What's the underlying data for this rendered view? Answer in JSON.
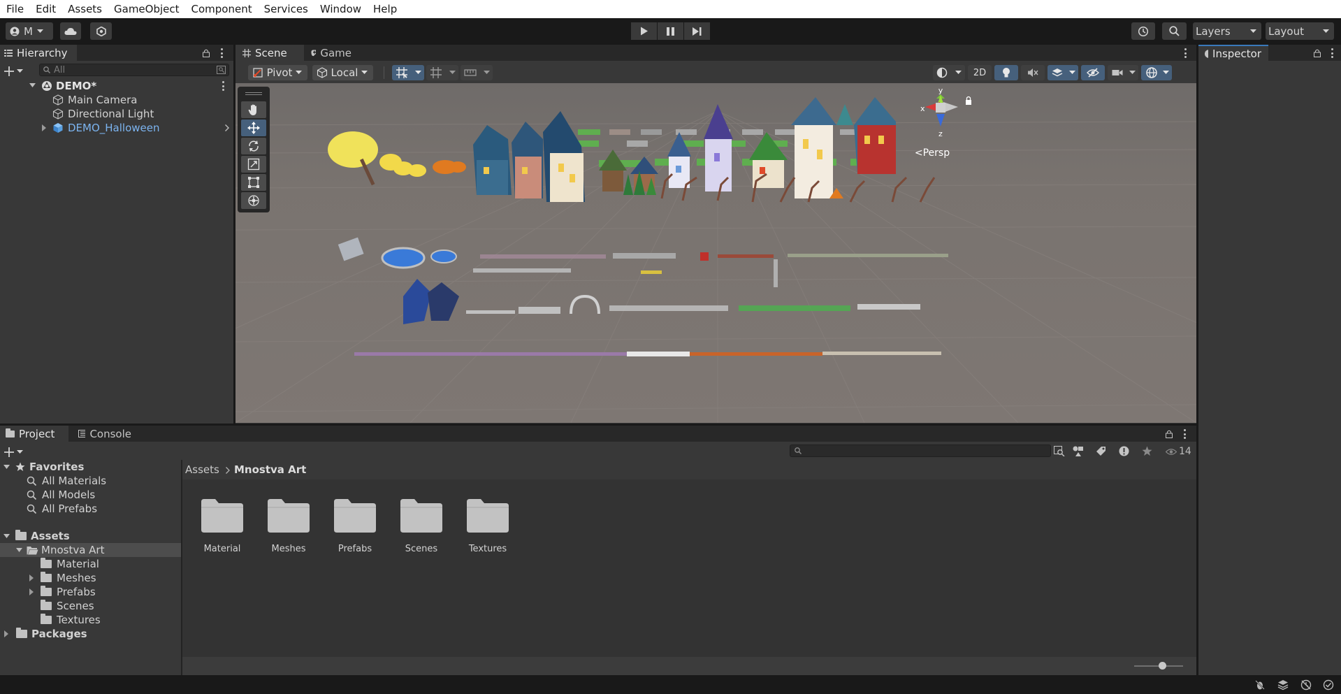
{
  "menu": [
    "File",
    "Edit",
    "Assets",
    "GameObject",
    "Component",
    "Services",
    "Window",
    "Help"
  ],
  "toolbar": {
    "account_label": "M",
    "layers_label": "Layers",
    "layout_label": "Layout"
  },
  "hierarchy": {
    "tab_label": "Hierarchy",
    "search_placeholder": "All",
    "scene_name": "DEMO*",
    "items": [
      {
        "label": "Main Camera",
        "icon": "gameobject-cube-icon"
      },
      {
        "label": "Directional Light",
        "icon": "gameobject-cube-icon"
      },
      {
        "label": "DEMO_Halloween",
        "icon": "prefab-cube-icon"
      }
    ]
  },
  "scene": {
    "tabs": [
      {
        "label": "Scene",
        "icon": "hash-icon"
      },
      {
        "label": "Game",
        "icon": "gamepad-icon"
      }
    ],
    "pivot_label": "Pivot",
    "local_label": "Local",
    "mode_2d_label": "2D",
    "persp_label": "<Persp",
    "gizmo_axes": {
      "x": "x",
      "y": "y",
      "z": "z"
    }
  },
  "inspector": {
    "tab_label": "Inspector"
  },
  "project": {
    "tabs": [
      {
        "label": "Project",
        "icon": "folder-icon"
      },
      {
        "label": "Console",
        "icon": "console-icon"
      }
    ],
    "hidden_count": "14",
    "favorites": {
      "label": "Favorites",
      "items": [
        "All Materials",
        "All Models",
        "All Prefabs"
      ]
    },
    "assets_label": "Assets",
    "selected_folder": "Mnostva Art",
    "subfolders": [
      "Material",
      "Meshes",
      "Prefabs",
      "Scenes",
      "Textures"
    ],
    "packages_label": "Packages",
    "breadcrumb": [
      "Assets",
      "Mnostva Art"
    ],
    "grid_folders": [
      "Material",
      "Meshes",
      "Prefabs",
      "Scenes",
      "Textures"
    ]
  },
  "colors": {
    "accent": "#3a79bb",
    "prefab_text": "#7cb4f0",
    "scene_bg": "#7a7471"
  }
}
